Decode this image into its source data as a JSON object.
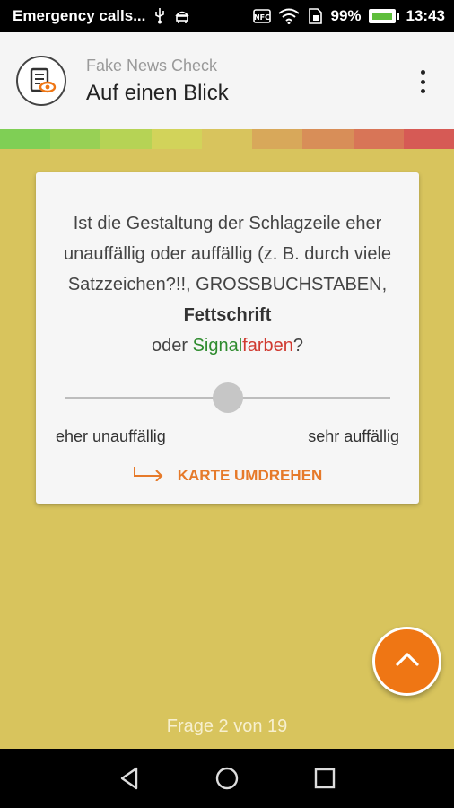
{
  "status_bar": {
    "carrier": "Emergency calls...",
    "battery": "99%",
    "time": "13:43",
    "icons": [
      "usb-icon",
      "android-debug-icon",
      "nfc-icon",
      "wifi-icon",
      "sim-icon",
      "battery-icon"
    ]
  },
  "app_bar": {
    "subtitle": "Fake News Check",
    "title": "Auf einen Blick",
    "menu_icon": "more-vert-icon"
  },
  "scale_colors": [
    "#7fcf55",
    "#98d055",
    "#b6d355",
    "#d2d35a",
    "#d8c45d",
    "#d8a85a",
    "#d88e58",
    "#d87557",
    "#d65a55"
  ],
  "card": {
    "question_parts": {
      "p1": "Ist die Gestaltung der Schlagzeile eher unauffällig oder auffällig (z. B. durch viele Satzzeichen?!!, GROSSBUCHSTABEN, ",
      "bold": "Fettschrift",
      "p2": "oder ",
      "green": "Signal",
      "red": "farben",
      "p3": "?"
    },
    "slider_value": 0.5,
    "label_left": "eher unauffällig",
    "label_right": "sehr auffällig",
    "flip_label": "KARTE UMDREHEN"
  },
  "fab_icon": "chevron-up-icon",
  "counter": "Frage 2 von 19",
  "nav": {
    "back_icon": "back-icon",
    "home_icon": "home-icon",
    "recents_icon": "recents-icon"
  },
  "colors": {
    "background": "#d8c45d",
    "accent": "#ef7614",
    "green_text": "#2e8b2e",
    "red_text": "#d03a30"
  }
}
